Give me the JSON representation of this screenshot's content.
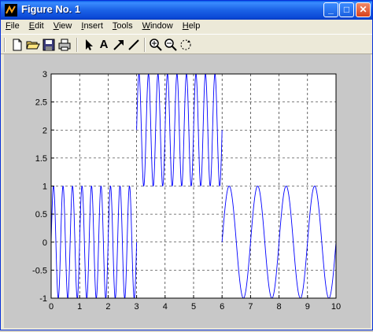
{
  "window": {
    "title": "Figure No. 1",
    "controls": {
      "minimize": "_",
      "maximize": "□",
      "close": "✕"
    }
  },
  "menu": [
    {
      "label": "File",
      "u": "F",
      "rest": "ile"
    },
    {
      "label": "Edit",
      "u": "E",
      "rest": "dit"
    },
    {
      "label": "View",
      "u": "V",
      "rest": "iew"
    },
    {
      "label": "Insert",
      "u": "I",
      "rest": "nsert"
    },
    {
      "label": "Tools",
      "u": "T",
      "rest": "ools"
    },
    {
      "label": "Window",
      "u": "W",
      "rest": "indow"
    },
    {
      "label": "Help",
      "u": "H",
      "rest": "elp"
    }
  ],
  "toolbar": {
    "icons": [
      "new-file-icon",
      "open-folder-icon",
      "save-icon",
      "print-icon",
      "arrow-select-icon",
      "text-A-icon",
      "arrow-tool-icon",
      "line-tool-icon",
      "zoom-in-icon",
      "zoom-out-icon",
      "rotate-icon"
    ],
    "text_tool": "A"
  },
  "chart_data": {
    "type": "line",
    "xlim": [
      0,
      10
    ],
    "ylim": [
      -1,
      3
    ],
    "x_ticks": [
      "0",
      "1",
      "2",
      "3",
      "4",
      "5",
      "6",
      "7",
      "8",
      "9",
      "10"
    ],
    "y_ticks": [
      "-1",
      "-0.5",
      "0",
      "0.5",
      "1",
      "1.5",
      "2",
      "2.5",
      "3"
    ],
    "grid": true,
    "line_color": "#0000ff",
    "series": [
      {
        "segment": 1,
        "x_range": [
          0,
          3
        ],
        "expression": "sin(2*pi*3*t)",
        "offset": 0,
        "frequency_hz": 3
      },
      {
        "segment": 2,
        "x_range": [
          3,
          6
        ],
        "expression": "2+sin(2*pi*3*t)",
        "offset": 2,
        "frequency_hz": 3
      },
      {
        "segment": 3,
        "x_range": [
          6,
          10
        ],
        "expression": "sin(2*pi*1*t)",
        "offset": 0,
        "frequency_hz": 1
      }
    ]
  }
}
